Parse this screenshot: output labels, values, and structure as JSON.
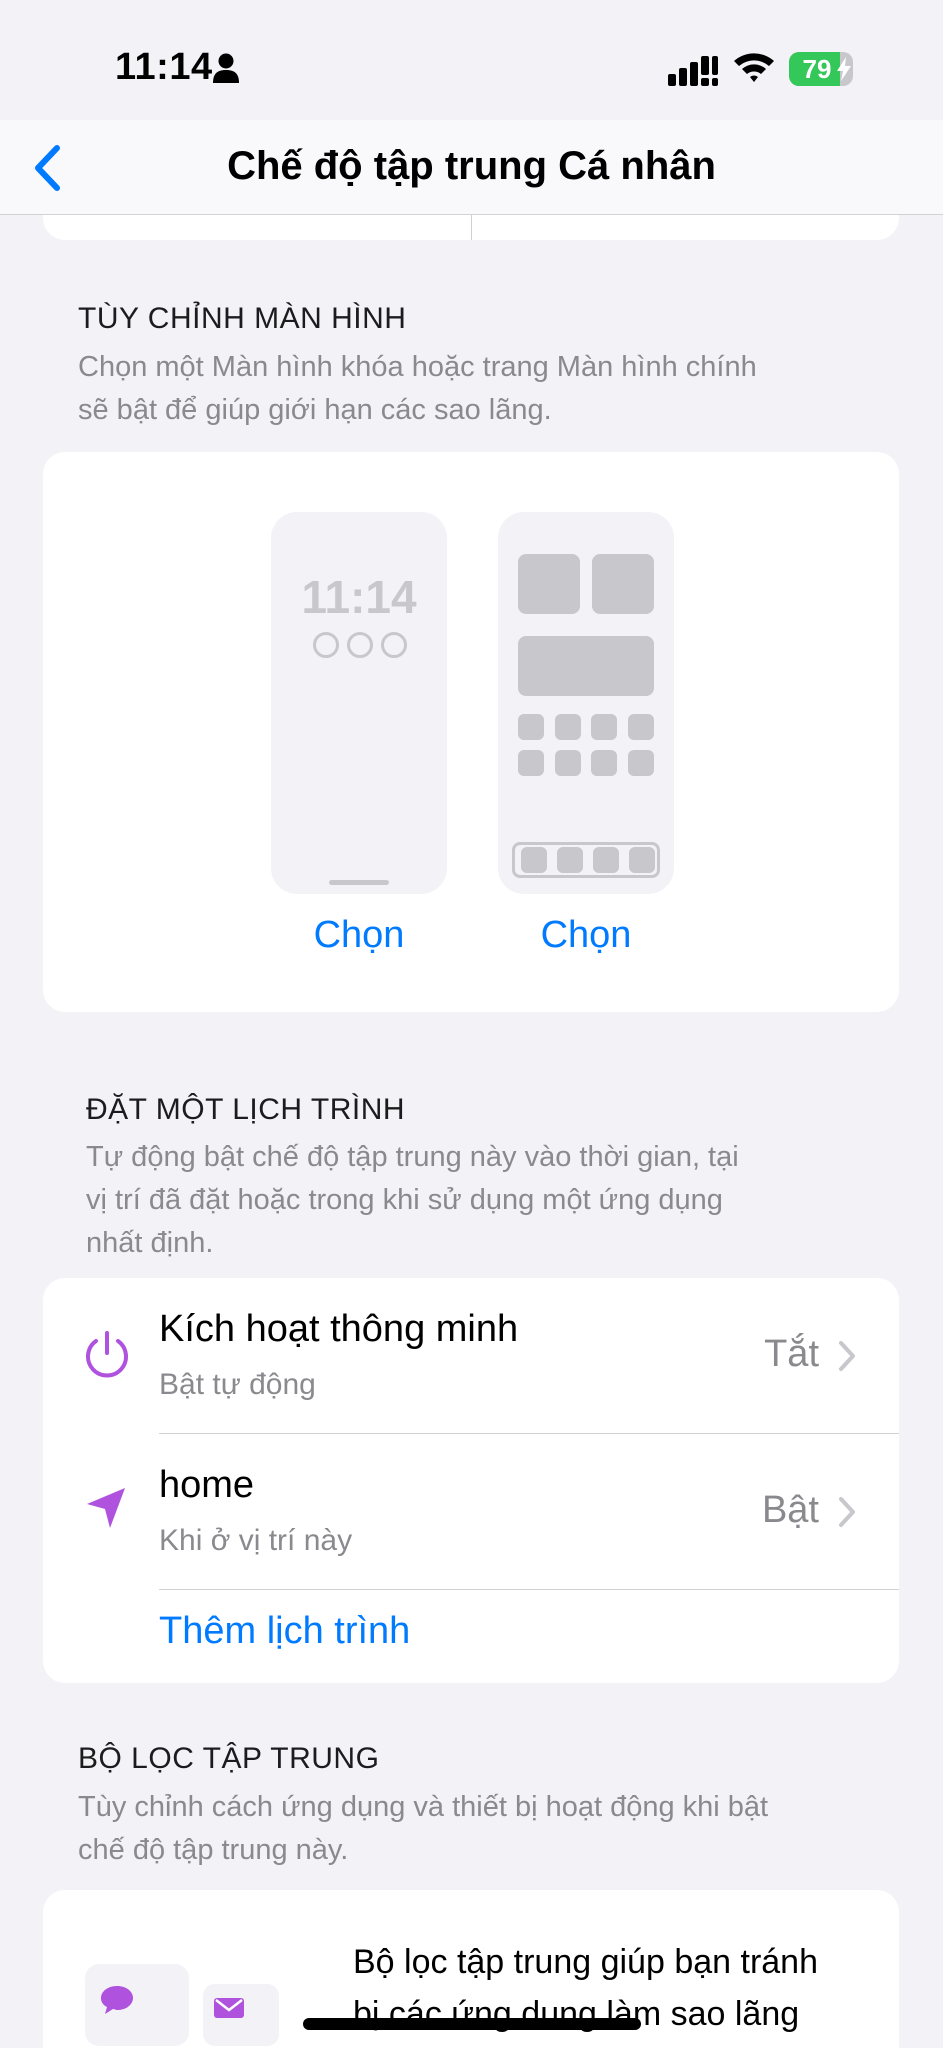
{
  "status_bar": {
    "time": "11:14",
    "battery": "79",
    "battery_level": 0.79,
    "battery_color": "#34c759"
  },
  "nav": {
    "title": "Chế độ tập trung Cá nhân",
    "back_icon": "chevron-left-icon"
  },
  "customize_screens": {
    "header": "TÙY CHỈNH MÀN HÌNH",
    "description_line1": "Chọn một Màn hình khóa hoặc trang Màn hình chính",
    "description_line2": "sẽ bật để giúp giới hạn các sao lãng.",
    "lock_screen_time": "11:14",
    "lock_choose": "Chọn",
    "home_choose": "Chọn"
  },
  "schedule": {
    "header": "ĐẶT MỘT LỊCH TRÌNH",
    "description_line1": "Tự động bật chế độ tập trung này vào thời gian, tại",
    "description_line2": "vị trí đã đặt hoặc trong khi sử dụng một ứng dụng",
    "description_line3": "nhất định.",
    "items": [
      {
        "icon": "power-icon",
        "title": "Kích hoạt thông minh",
        "subtitle": "Bật tự động",
        "value": "Tắt"
      },
      {
        "icon": "location-arrow-icon",
        "title": "home",
        "subtitle": "Khi ở vị trí này",
        "value": "Bật"
      }
    ],
    "add_label": "Thêm lịch trình",
    "accent_color": "#af52de"
  },
  "focus_filters": {
    "header": "BỘ LỌC TẬP TRUNG",
    "description_line1": "Tùy chỉnh cách ứng dụng và thiết bị hoạt động khi bật",
    "description_line2": "chế độ tập trung này.",
    "text_line1": "Bộ lọc tập trung giúp bạn tránh",
    "text_line2": "bị các ứng dụng làm sao lãng"
  }
}
